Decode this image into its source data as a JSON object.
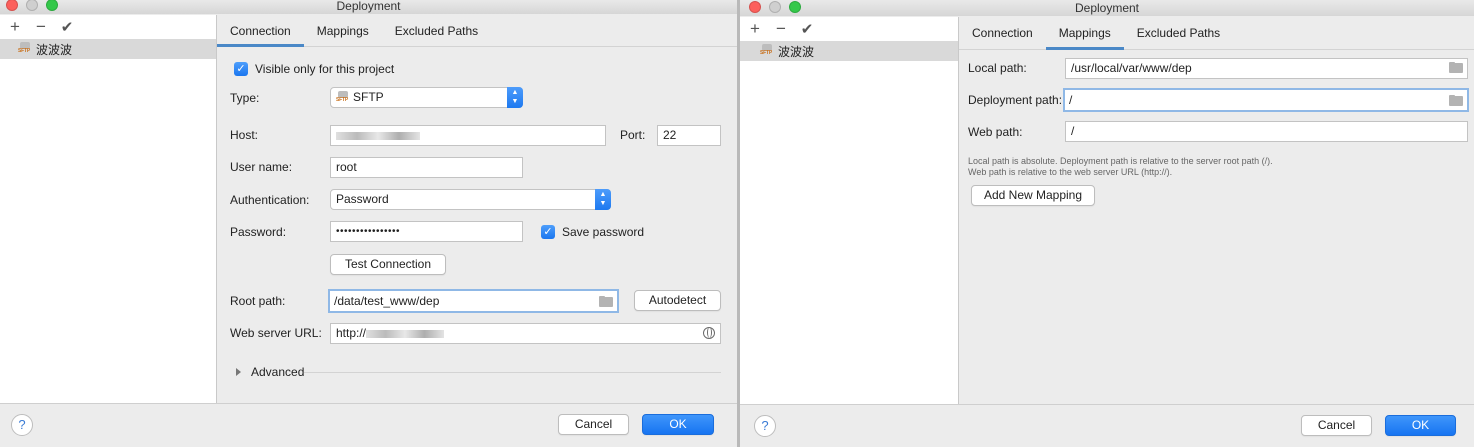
{
  "left_window": {
    "title": "Deployment",
    "toolbar": {
      "add": "+",
      "remove": "−",
      "apply": "✔"
    },
    "server": {
      "name": "波波波",
      "icon": "sftp-icon",
      "icon_label": "SFTP"
    },
    "tabs": [
      "Connection",
      "Mappings",
      "Excluded Paths"
    ],
    "active_tab": "Connection",
    "connection": {
      "visible_only_label": "Visible only for this project",
      "visible_only_checked": true,
      "type_label": "Type:",
      "type_value": "SFTP",
      "host_label": "Host:",
      "host_value": "",
      "port_label": "Port:",
      "port_value": "22",
      "username_label": "User name:",
      "username_value": "root",
      "auth_label": "Authentication:",
      "auth_value": "Password",
      "password_label": "Password:",
      "password_value": "••••••••••••••••",
      "save_password_label": "Save password",
      "save_password_checked": true,
      "test_connection": "Test Connection",
      "root_path_label": "Root path:",
      "root_path_value": "/data/test_www/dep",
      "autodetect": "Autodetect",
      "web_url_label": "Web server URL:",
      "web_url_value": "http://",
      "advanced": "Advanced"
    },
    "footer": {
      "help": "?",
      "cancel": "Cancel",
      "ok": "OK"
    }
  },
  "right_window": {
    "title": "Deployment",
    "toolbar": {
      "add": "+",
      "remove": "−",
      "apply": "✔"
    },
    "server": {
      "name": "波波波",
      "icon": "sftp-icon",
      "icon_label": "SFTP"
    },
    "tabs": [
      "Connection",
      "Mappings",
      "Excluded Paths"
    ],
    "active_tab": "Mappings",
    "mappings": {
      "local_path_label": "Local path:",
      "local_path_value": "/usr/local/var/www/dep",
      "deployment_path_label": "Deployment path:",
      "deployment_path_value": "/",
      "web_path_label": "Web path:",
      "web_path_value": "/",
      "hint_line1": "Local path is absolute. Deployment path is relative to the server root path (/).",
      "hint_line2": "Web path is relative to the web server URL (http://).",
      "add_mapping": "Add New Mapping"
    },
    "footer": {
      "help": "?",
      "cancel": "Cancel",
      "ok": "OK"
    }
  },
  "colors": {
    "accent": "#1a76ef",
    "focus_ring": "#8fb8e6",
    "close": "#fc605c",
    "zoom": "#34c84a"
  }
}
